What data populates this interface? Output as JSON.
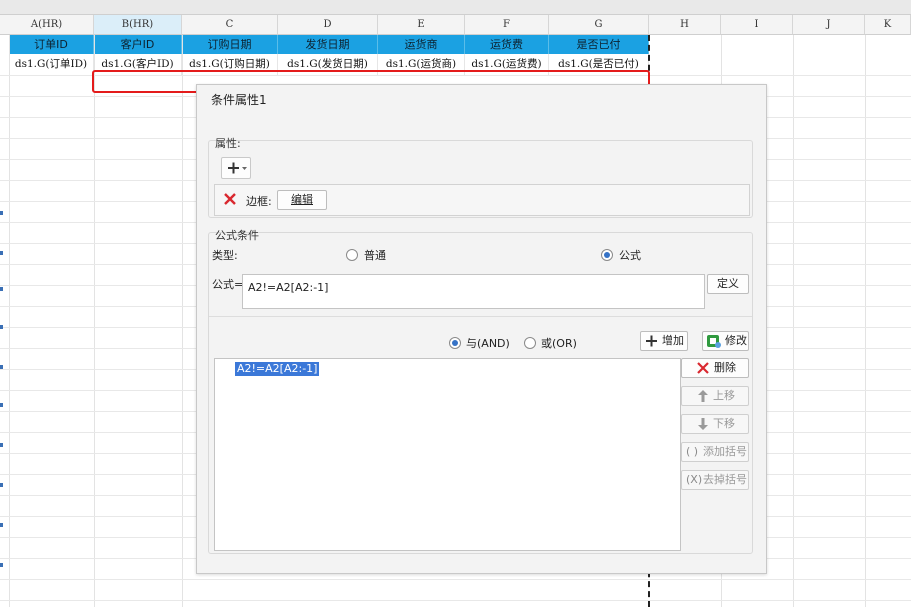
{
  "columns": [
    {
      "letter": "A(HR)",
      "header": "订单ID",
      "cell": "ds1.G(订单ID)"
    },
    {
      "letter": "B(HR)",
      "header": "客户ID",
      "cell": "ds1.G(客户ID)"
    },
    {
      "letter": "C",
      "header": "订购日期",
      "cell": "ds1.G(订购日期)"
    },
    {
      "letter": "D",
      "header": "发货日期",
      "cell": "ds1.G(发货日期)"
    },
    {
      "letter": "E",
      "header": "运货商",
      "cell": "ds1.G(运货商)"
    },
    {
      "letter": "F",
      "header": "运货费",
      "cell": "ds1.G(运货费)"
    },
    {
      "letter": "G",
      "header": "是否已付",
      "cell": "ds1.G(是否已付)"
    },
    {
      "letter": "H",
      "header": "",
      "cell": ""
    },
    {
      "letter": "I",
      "header": "",
      "cell": ""
    },
    {
      "letter": "J",
      "header": "",
      "cell": ""
    },
    {
      "letter": "K",
      "header": "",
      "cell": ""
    }
  ],
  "colors": {
    "header_fill": "#1ba1e2",
    "highlight_border": "#e41b1b",
    "selected_col": "#dbeef9"
  },
  "dialog": {
    "title": "条件属性1",
    "attributes": {
      "label": "属性:",
      "add_icon": "plus-icon",
      "border_label": "边框:",
      "edit_button": "编辑"
    },
    "formula_condition": {
      "label": "公式条件",
      "type_label": "类型:",
      "type_options": [
        "普通",
        "公式"
      ],
      "type_selected": "公式",
      "formula_label": "公式=",
      "formula_value": "A2!=A2[A2:-1]",
      "define_button": "定义",
      "logic_options": [
        "与(AND)",
        "或(OR)"
      ],
      "logic_selected": "与(AND)",
      "add_button": "增加",
      "modify_button": "修改",
      "conditions": [
        "A2!=A2[A2:-1]"
      ],
      "delete_button": "删除",
      "up_button": "上移",
      "down_button": "下移",
      "add_bracket_button": "添加括号",
      "remove_bracket_button": "去掉括号"
    }
  }
}
